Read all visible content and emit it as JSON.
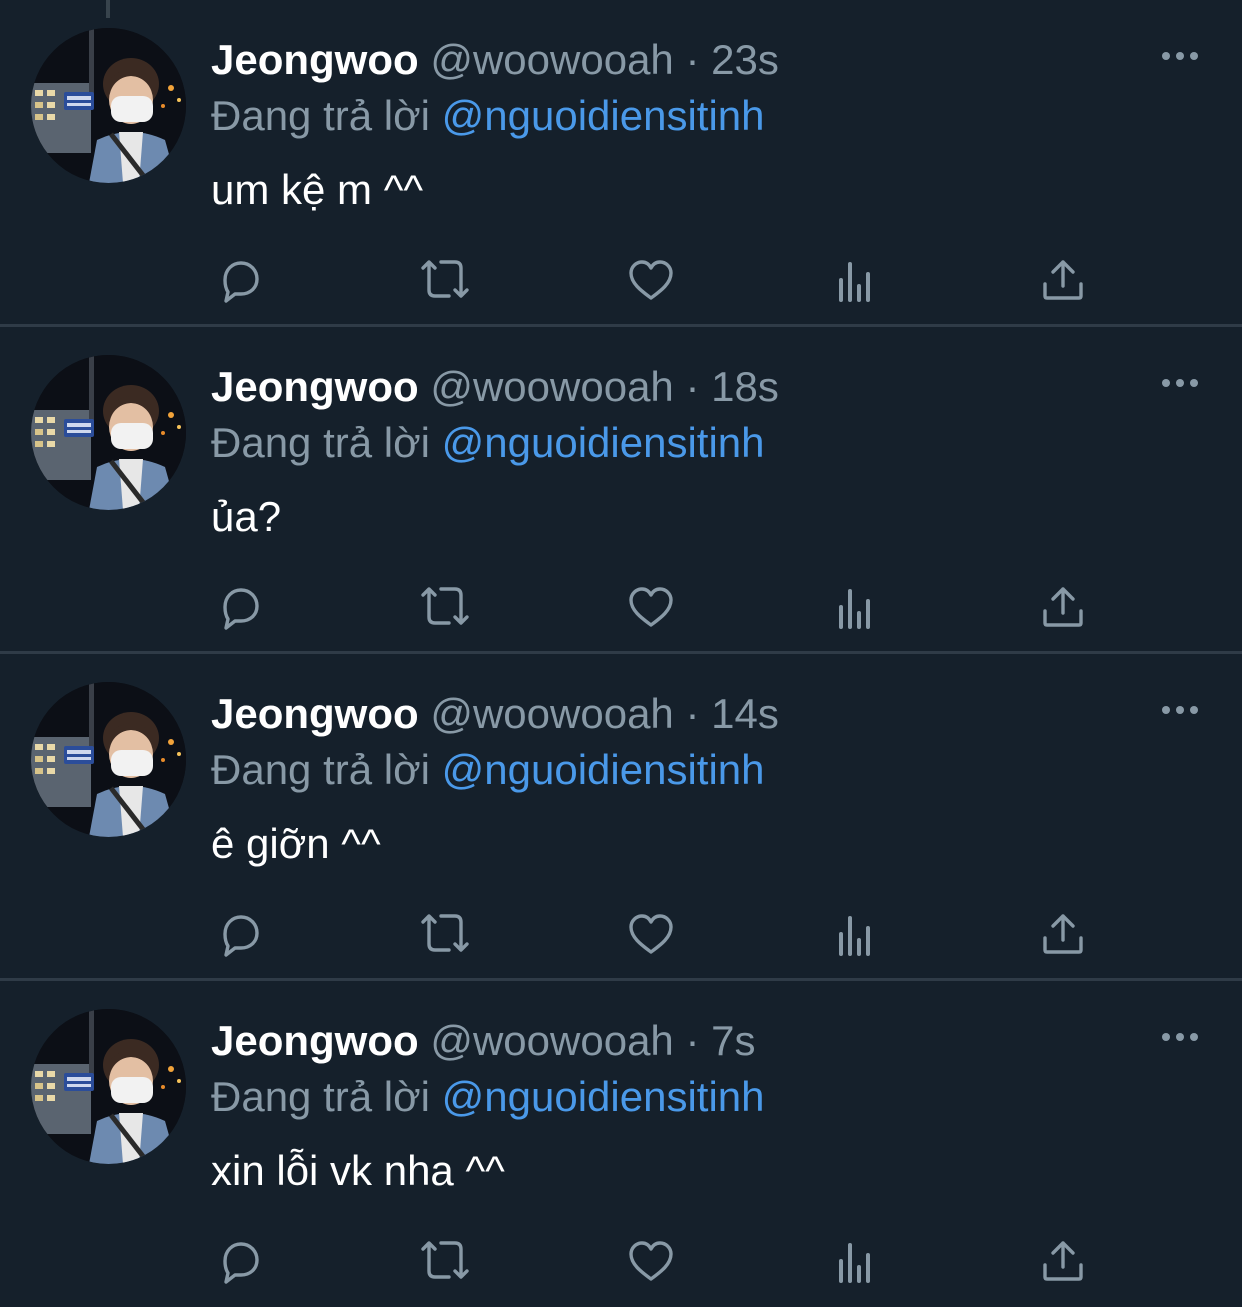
{
  "colors": {
    "background": "#15202b",
    "divider": "#2f3b47",
    "text_primary": "#ffffff",
    "text_secondary": "#8899a6",
    "link": "#4a99e9"
  },
  "icons": {
    "reply": "speech-bubble-icon",
    "retweet": "retweet-arrows-icon",
    "like": "heart-icon",
    "views": "bar-chart-icon",
    "share": "upload-share-icon",
    "more": "three-dots-icon"
  },
  "tweets": [
    {
      "name": "Jeongwoo",
      "handle": "@woowooah",
      "separator": "·",
      "time": "23s",
      "reply_prefix": "Đang trả lời",
      "reply_to": "@nguoidiensitinh",
      "text": "um kệ m ^^"
    },
    {
      "name": "Jeongwoo",
      "handle": "@woowooah",
      "separator": "·",
      "time": "18s",
      "reply_prefix": "Đang trả lời",
      "reply_to": "@nguoidiensitinh",
      "text": "ủa?"
    },
    {
      "name": "Jeongwoo",
      "handle": "@woowooah",
      "separator": "·",
      "time": "14s",
      "reply_prefix": "Đang trả lời",
      "reply_to": "@nguoidiensitinh",
      "text": "ê giỡn ^^"
    },
    {
      "name": "Jeongwoo",
      "handle": "@woowooah",
      "separator": "·",
      "time": "7s",
      "reply_prefix": "Đang trả lời",
      "reply_to": "@nguoidiensitinh",
      "text": "xin lỗi vk nha ^^"
    }
  ]
}
